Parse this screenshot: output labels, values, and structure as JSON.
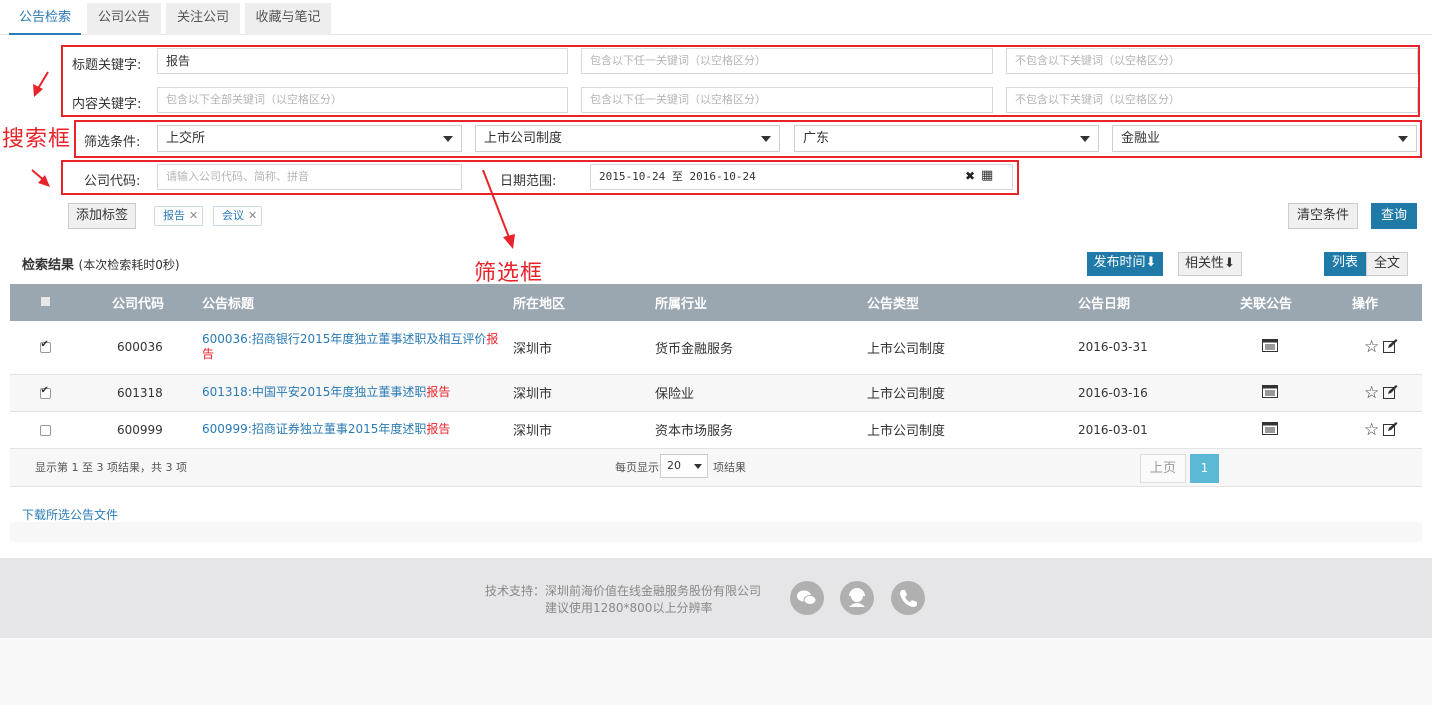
{
  "tabs": [
    "公告检索",
    "公司公告",
    "关注公司",
    "收藏与笔记"
  ],
  "annotations": {
    "search_box": "搜索框",
    "filter_box": "筛选框"
  },
  "search": {
    "title_label": "标题关键字:",
    "title_value": "报告",
    "any_placeholder": "包含以下任一关键词（以空格区分）",
    "exclude_placeholder": "不包含以下关键词（以空格区分）",
    "content_label": "内容关键字:",
    "all_placeholder": "包含以下全部关键词（以空格区分）"
  },
  "filter": {
    "label": "筛选条件:",
    "exchange": "上交所",
    "category": "上市公司制度",
    "region": "广东",
    "industry": "金融业"
  },
  "company": {
    "label": "公司代码:",
    "placeholder": "请输入公司代码、简称、拼音"
  },
  "date": {
    "label": "日期范围:",
    "value": "2015-10-24 至 2016-10-24",
    "clear_icon": "✖",
    "calendar_icon": "▦"
  },
  "tags": {
    "add_label": "添加标签",
    "items": [
      "报告",
      "会议"
    ]
  },
  "actions": {
    "clear_label": "清空条件",
    "query_label": "查询"
  },
  "results": {
    "title": "检索结果",
    "subtitle": "(本次检索耗时0秒)",
    "sort_time": "发布时间",
    "sort_relevance": "相关性",
    "view_list": "列表",
    "view_full": "全文",
    "sort_arrow": "⬇"
  },
  "table": {
    "headers": [
      "公司代码",
      "公告标题",
      "所在地区",
      "所属行业",
      "公告类型",
      "公告日期",
      "关联公告",
      "操作"
    ],
    "rows": [
      {
        "checked": true,
        "code": "600036",
        "title_code": "600036",
        "title_text": ":招商银行2015年度独立董事述职及相互评价",
        "title_hl": "报告",
        "region": "深圳市",
        "industry": "货币金融服务",
        "type": "上市公司制度",
        "date": "2016-03-31"
      },
      {
        "checked": true,
        "code": "601318",
        "title_code": "601318",
        "title_text": ":中国平安2015年度独立董事述职",
        "title_hl": "报告",
        "region": "深圳市",
        "industry": "保险业",
        "type": "上市公司制度",
        "date": "2016-03-16"
      },
      {
        "checked": false,
        "code": "600999",
        "title_code": "600999",
        "title_text": ":招商证券独立董事2015年度述职",
        "title_hl": "报告",
        "region": "深圳市",
        "industry": "资本市场服务",
        "type": "上市公司制度",
        "date": "2016-03-01"
      }
    ]
  },
  "pager": {
    "summary": "显示第 1 至 3 项结果，共 3 项",
    "per_page_prefix": "每页显示",
    "per_page_value": "20",
    "per_page_suffix": "项结果",
    "prev": "上页",
    "current": "1"
  },
  "download_label": "下载所选公告文件",
  "footer": {
    "line1": "技术支持：深圳前海价值在线金融服务股份有限公司",
    "line2": "建议使用1280*800以上分辨率"
  },
  "colors": {
    "accent": "#1f7aa8",
    "annotation": "#e8242a",
    "table_header": "#9aa6b0"
  }
}
